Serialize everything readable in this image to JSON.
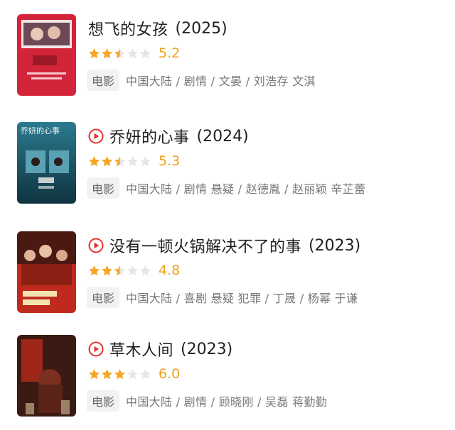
{
  "movies": [
    {
      "title": "想飞的女孩",
      "year": "(2025)",
      "has_play": false,
      "rating": 2.5,
      "score": "5.2",
      "tag": "电影",
      "meta": "中国大陆 / 剧情 / 文晏 / 刘浩存 文淇",
      "poster_icon": "poster-red",
      "colors": {
        "bg": "#d3243a",
        "accent": "#9a1a28"
      }
    },
    {
      "title": "乔妍的心事",
      "year": "(2024)",
      "has_play": true,
      "rating": 2.5,
      "score": "5.3",
      "tag": "电影",
      "meta": "中国大陆 / 剧情 悬疑 / 赵德胤 / 赵丽颖 辛芷蕾",
      "poster_icon": "poster-teal",
      "poster_text": "乔妍的心事",
      "colors": {
        "bg": "#1e5f73",
        "accent": "#0f3340"
      }
    },
    {
      "title": "没有一顿火锅解决不了的事",
      "year": "(2023)",
      "has_play": true,
      "rating": 2.5,
      "score": "4.8",
      "tag": "电影",
      "meta": "中国大陆 / 喜剧 悬疑 犯罪 / 丁晟 / 杨幂 于谦",
      "poster_icon": "poster-red-crowd",
      "colors": {
        "bg": "#c02a1e",
        "accent": "#4a1a12"
      }
    },
    {
      "title": "草木人间",
      "year": "(2023)",
      "has_play": true,
      "rating": 3,
      "score": "6.0",
      "tag": "电影",
      "meta": "中国大陆 / 剧情 / 顾晓刚 / 吴磊 蒋勤勤",
      "poster_icon": "poster-dark-red",
      "colors": {
        "bg": "#3a1a12",
        "accent": "#b02a1c"
      }
    }
  ],
  "theme": {
    "star_on": "#f5a623",
    "star_off": "#e6e6e6",
    "play": "#e5322d"
  }
}
